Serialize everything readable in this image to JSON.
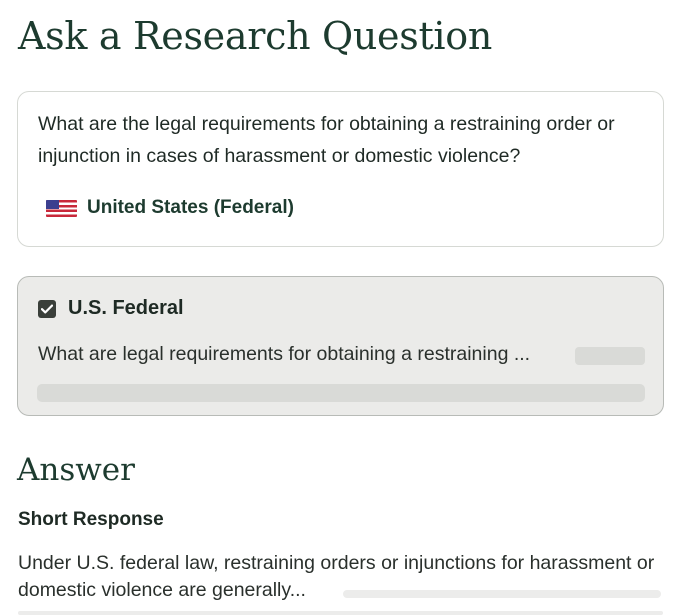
{
  "header": {
    "title": "Ask a Research Question"
  },
  "question": {
    "text": "What are the legal requirements for obtaining a restraining order or injunction in cases of harassment or domestic violence?",
    "jurisdiction": {
      "flag_icon": "us-flag-icon",
      "label": "United States (Federal)"
    }
  },
  "research": {
    "checked": true,
    "jurisdiction_label": "U.S. Federal",
    "query": "What are legal requirements for obtaining a restraining ..."
  },
  "answer": {
    "heading": "Answer",
    "section_label": "Short Response",
    "text": "Under U.S. federal law, restraining orders or injunctions for harassment or domestic violence are generally..."
  },
  "colors": {
    "heading": "#1d3b2f",
    "card_border": "#d6d9d4",
    "search_card_bg": "#ebebe9",
    "skeleton": "#d9dad7",
    "checkbox": "#3a3f3a"
  }
}
